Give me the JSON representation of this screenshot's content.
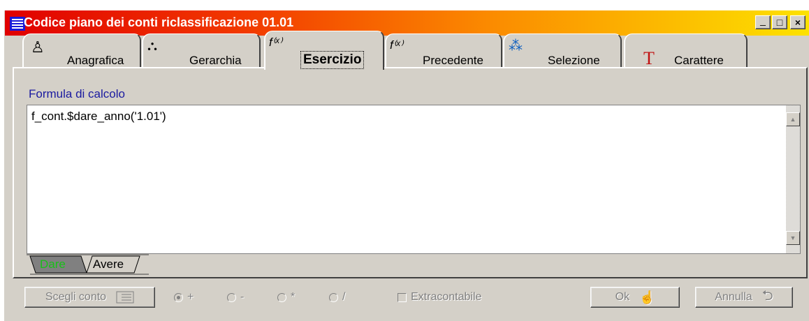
{
  "window": {
    "title": "Codice piano dei conti riclassificazione 01.01",
    "controls": {
      "minimize": "_",
      "maximize": "□",
      "close": "×"
    }
  },
  "tabs": [
    {
      "label": "Anagrafica",
      "icon": "person-stamp-icon",
      "icon_glyph": "♙"
    },
    {
      "label": "Gerarchia",
      "icon": "hierarchy-icon",
      "icon_glyph": "⛬"
    },
    {
      "label": "Esercizio",
      "icon": "function-icon",
      "icon_glyph": "f⁽ˣ⁾",
      "active": true
    },
    {
      "label": "Precedente",
      "icon": "function-icon",
      "icon_glyph": "f⁽ˣ⁾"
    },
    {
      "label": "Selezione",
      "icon": "selection-icon",
      "icon_glyph": "⁂"
    },
    {
      "label": "Carattere",
      "icon": "font-icon",
      "icon_glyph": "T"
    }
  ],
  "formula": {
    "label": "Formula di calcolo",
    "value": "f_cont.$dare_anno('1.01')"
  },
  "subtabs": [
    {
      "label": "Dare",
      "active": true
    },
    {
      "label": "Avere",
      "active": false
    }
  ],
  "bottom": {
    "choose_account": "Scegli conto",
    "operators": [
      {
        "symbol": "+",
        "selected": true
      },
      {
        "symbol": "-",
        "selected": false
      },
      {
        "symbol": "*",
        "selected": false
      },
      {
        "symbol": "/",
        "selected": false
      }
    ],
    "extracontabile": "Extracontabile",
    "ok": "Ok",
    "cancel": "Annulla"
  },
  "colors": {
    "title_gradient_start": "#e00000",
    "title_gradient_end": "#fde200",
    "formula_label": "#1a1aa0",
    "active_subtab_text": "#18c018",
    "face": "#d4d0c8"
  }
}
